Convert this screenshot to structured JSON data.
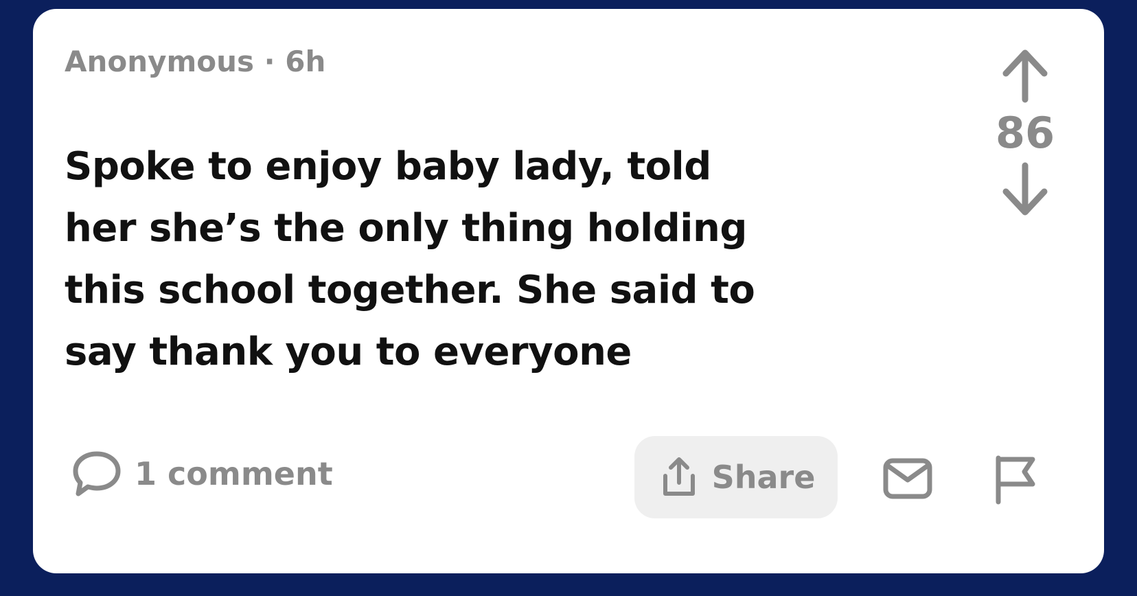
{
  "post": {
    "author": "Anonymous",
    "separator": "·",
    "age": "6h",
    "meta_text": "Anonymous · 6h",
    "body": "Spoke to enjoy baby lady, told her she’s the only thing holding this school together. She said to say thank you to everyone"
  },
  "vote": {
    "count": "86",
    "upvote_icon": "arrow-up-icon",
    "downvote_icon": "arrow-down-icon"
  },
  "footer": {
    "comments_label": "1 comment",
    "comments_icon": "speech-bubble-icon",
    "share_label": "Share",
    "share_icon": "share-upload-icon",
    "message_icon": "envelope-icon",
    "report_icon": "flag-icon"
  },
  "colors": {
    "background": "#0b1f5c",
    "card": "#ffffff",
    "text_primary": "#111111",
    "text_muted": "#8a8a8a",
    "share_bg": "#efefef"
  }
}
